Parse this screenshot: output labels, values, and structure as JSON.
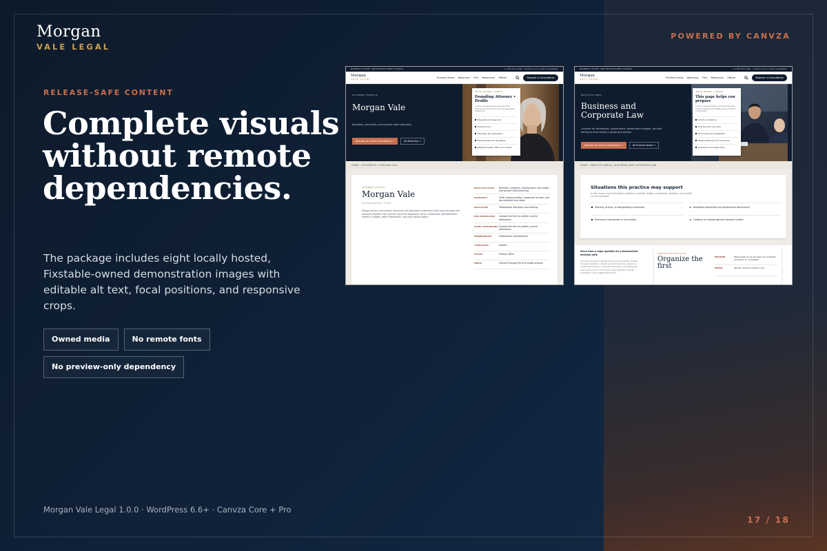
{
  "brand": {
    "line1": "Morgan",
    "line2": "VALE LEGAL"
  },
  "powered_by": "POWERED BY CANVZA",
  "eyebrow": "RELEASE-SAFE CONTENT",
  "headline": "Complete visuals without remote dependencies.",
  "lede": "The package includes eight locally hosted, Fixstable-owned demonstration images with editable alt text, focal positions, and responsive crops.",
  "chips": [
    "Owned media",
    "No remote fonts",
    "No preview-only dependency"
  ],
  "footer": "Morgan Vale Legal 1.0.0 · WordPress 6.6+ · Canvza Core + Pro",
  "pager": "17 / 18",
  "colors": {
    "accent": "#c96f4e",
    "gold": "#c89e56",
    "navy": "#0f1c2d"
  },
  "site": {
    "utility_text": "BUSINESS, ESTATE, AND PRIVATE CLIENT COUNSEL",
    "utility_phone": "+1 555 010 2000",
    "utility_note": "Contact us to confirm availability",
    "logo1": "Morgan",
    "logo2": "VALE LEGAL",
    "nav": [
      "Practice Areas",
      "Attorneys",
      "Firm",
      "Resources",
      "Offices"
    ],
    "cta": "Request a Consultation"
  },
  "shot_a": {
    "hero_eyebrow": "ATTORNEY PROFILE",
    "hero_title": "Morgan Vale",
    "hero_desc": "Business, contracts, and private client planning",
    "btn_primary": "Request an Initial Consultation →",
    "btn_secondary": "All Attorneys →",
    "card_eyebrow": "INITIAL REVIEW • SAMPLE",
    "card_title": "Founding Attorney • Profile",
    "card_desc": "A short, review-friendly overview of the attorney's practice focus and representative experience.",
    "card_items": [
      "Biography and approach",
      "Practice focus",
      "Education and admissions",
      "Memberships and languages",
      "Related insights, office and contact"
    ],
    "crumb": "HOME  /  ATTORNEYS  /  MORGAN VALE",
    "profile_eyebrow": "ATTORNEY PROFILE",
    "profile_name": "Morgan Vale",
    "profile_role": "Founding Attorney · Profile",
    "profile_desc": "Morgan brings a structured, document-led approach to decisions that cross business and personal priorities. Her practice connects biography, focus, credentials, representative matters, insights, office information, and next contact paths.",
    "rows": [
      {
        "k": "PRACTICE FOCUS",
        "v": "Business, contracts, employment, real estate, and private client planning"
      },
      {
        "k": "APPROACH",
        "v": "Clear communication, organized records, and documented next steps"
      },
      {
        "k": "EDUCATION",
        "v": "Professional education and training"
      },
      {
        "k": "BAR ADMISSIONS",
        "v": "Contact the firm to confirm current admissions"
      },
      {
        "k": "COURT ADMISSIONS",
        "v": "Contact the firm to confirm current admissions"
      },
      {
        "k": "MEMBERSHIPS",
        "v": "Professional memberships"
      },
      {
        "k": "LANGUAGES",
        "v": "English"
      },
      {
        "k": "OFFICE",
        "v": "Primary office"
      },
      {
        "k": "MEDIA",
        "v": "Contact through the firm intake process"
      }
    ]
  },
  "shot_b": {
    "hero_eyebrow": "PRACTICE AREA",
    "hero_title": "Business and Corporate Law",
    "hero_desc": "Counsel for formations, governance, ownership changes, and the decisions that shape a growing business.",
    "btn_primary": "Request an Initial Consultation →",
    "btn_secondary": "All Practice Areas →",
    "card_eyebrow": "INITIAL REVIEW • SAMPLE",
    "card_title": "This page helps you prepare",
    "card_desc": "A short, review-friendly summary that helps visitors organize their matter before the first conversation.",
    "card_items": [
      "Common situations",
      "How the work may flow",
      "Documents and preparation",
      "Related attorneys and resources",
      "Jurisdiction and legal notice"
    ],
    "crumb": "HOME  /  PRACTICE AREAS  /  BUSINESS AND CORPORATE LAW",
    "sit_title": "Situations this practice may support",
    "sit_desc": "A real lawyer must still confirm whether a specific matter, jurisdiction, deadline, and conflict can be accepted.",
    "sit_items": [
      "Starting, buying, or reorganizing a business.",
      "Reviewing ownership and governance documents.",
      "Planning a transaction or succession.",
      "Creating an outside general counsel rhythm."
    ],
    "lower_title": "Move from a legal question to a documented decision path",
    "lower_desc": "Counsel may help organize facts and documents, identify the legal questions, explain practical options, prepare or review instruments, coordinate execution, and define the next review point. The actual scope depends on facts, jurisdiction, and engagement terms.",
    "box_eyebrow": "PREPARATION CHECKLIST",
    "box_title": "Organize the first",
    "box_rows": [
      {
        "k": "DECISION",
        "v": "What needs to be decided, documented, reviewed, or completed"
      },
      {
        "k": "PEOPLE",
        "v": "Parties, decision-makers, and"
      }
    ]
  }
}
